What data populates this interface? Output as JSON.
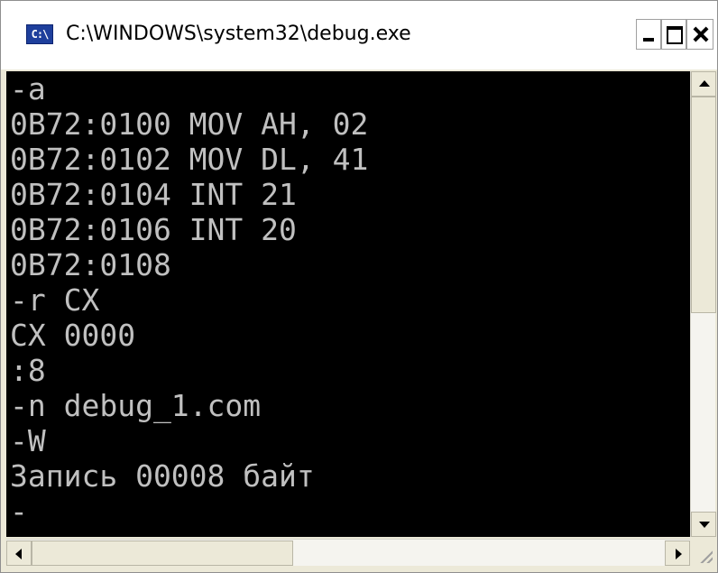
{
  "window": {
    "title": "C:\\WINDOWS\\system32\\debug.exe",
    "icon_text": "C:\\"
  },
  "icons": {
    "app": "console-app-icon",
    "minimize": "minimize-icon",
    "maximize": "maximize-icon",
    "close": "close-icon",
    "scroll_up": "arrow-up-icon",
    "scroll_down": "arrow-down-icon",
    "scroll_left": "arrow-left-icon",
    "scroll_right": "arrow-right-icon",
    "size_grip": "size-grip-icon"
  },
  "console": {
    "lines": [
      "-a",
      "0B72:0100 MOV AH, 02",
      "0B72:0102 MOV DL, 41",
      "0B72:0104 INT 21",
      "0B72:0106 INT 20",
      "0B72:0108",
      "-r CX",
      "CX 0000",
      ":8",
      "-n debug_1.com",
      "-W",
      "Запись 00008 байт",
      "-"
    ]
  },
  "colors": {
    "console_bg": "#000000",
    "console_text": "#c0c0c0",
    "frame": "#ece9d8"
  }
}
